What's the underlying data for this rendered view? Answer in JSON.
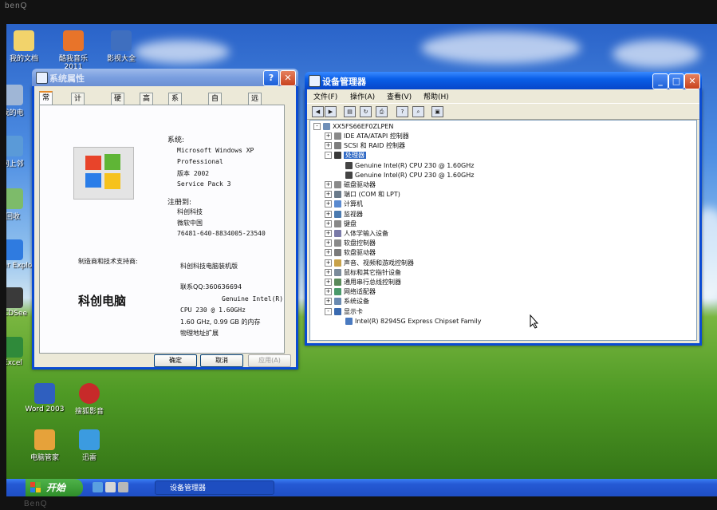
{
  "bezel": {
    "brand_top": "benQ",
    "brand_bottom": "BenQ"
  },
  "desktop": {
    "icons": [
      {
        "label": "我的文档"
      },
      {
        "label": "酷我音乐 2011"
      },
      {
        "label": "影视大全"
      },
      {
        "label": "我的电"
      },
      {
        "label": "网上邻"
      },
      {
        "label": "回收"
      },
      {
        "label": "Inter Explo"
      },
      {
        "label": "ACDSee"
      },
      {
        "label": "Excel"
      },
      {
        "label": "Word 2003"
      },
      {
        "label": "搜狐影音"
      },
      {
        "label": "电脑管家"
      },
      {
        "label": "迅雷"
      }
    ]
  },
  "sys_props": {
    "title": "系统属性",
    "help_btn": "?",
    "close_btn": "✕",
    "tabs": [
      "常规",
      "计算机名",
      "硬件",
      "高级",
      "系统还原",
      "自动更新",
      "远程"
    ],
    "system_label": "系统:",
    "os_lines": [
      "Microsoft Windows XP",
      "Professional",
      "版本 2002",
      "Service Pack 3"
    ],
    "registered_label": "注册到:",
    "reg_lines": [
      "科创科技",
      "微软中国",
      "76481-640-8834005-23540"
    ],
    "oem_label": "制造商和技术支持商:",
    "oem_logo_text": "科创电脑",
    "oem_lines": [
      "科创科技电脑装机版",
      "",
      "联系QQ:360636694"
    ],
    "hw_lines": [
      "Genuine Intel(R)",
      "CPU  230   @ 1.60GHz",
      "1.60 GHz, 0.99 GB 的内存",
      "物理地址扩展"
    ],
    "buttons": {
      "ok": "确定",
      "cancel": "取消",
      "apply": "应用(A)"
    }
  },
  "dev_mgr": {
    "title": "设备管理器",
    "controls": {
      "min": "_",
      "max": "□",
      "close": "✕"
    },
    "menu": [
      "文件(F)",
      "操作(A)",
      "查看(V)",
      "帮助(H)"
    ],
    "toolbar_icons": [
      "back-arrow-icon",
      "forward-arrow-icon",
      "properties-icon",
      "refresh-icon",
      "print-icon",
      "help-icon",
      "scan-hardware-icon",
      "device-icon"
    ],
    "computer_name": "XX5FS66EF0ZLPEN",
    "nodes": [
      {
        "label": "IDE ATA/ATAPI 控制器",
        "expander": "+"
      },
      {
        "label": "SCSI 和 RAID 控制器",
        "expander": "+"
      },
      {
        "label": "处理器",
        "expander": "-",
        "selected": true
      },
      {
        "label": "Genuine Intel(R) CPU  230   @ 1.60GHz",
        "child": true
      },
      {
        "label": "Genuine Intel(R) CPU  230   @ 1.60GHz",
        "child": true
      },
      {
        "label": "磁盘驱动器",
        "expander": "+"
      },
      {
        "label": "端口 (COM 和 LPT)",
        "expander": "+"
      },
      {
        "label": "计算机",
        "expander": "+"
      },
      {
        "label": "监视器",
        "expander": "+"
      },
      {
        "label": "键盘",
        "expander": "+"
      },
      {
        "label": "人体学输入设备",
        "expander": "+"
      },
      {
        "label": "软盘控制器",
        "expander": "+"
      },
      {
        "label": "软盘驱动器",
        "expander": "+"
      },
      {
        "label": "声音、视频和游戏控制器",
        "expander": "+"
      },
      {
        "label": "鼠标和其它指针设备",
        "expander": "+"
      },
      {
        "label": "通用串行总线控制器",
        "expander": "+"
      },
      {
        "label": "网络适配器",
        "expander": "+"
      },
      {
        "label": "系统设备",
        "expander": "+"
      },
      {
        "label": "显示卡",
        "expander": "-"
      },
      {
        "label": "Intel(R) 82945G Express Chipset Family",
        "child": true
      }
    ]
  },
  "taskbar": {
    "start_label": "开始",
    "task_item": "设备管理器"
  },
  "colors": {
    "xp_blue": "#0a4bd3",
    "selection": "#316ac5",
    "start_green": "#3a9a34"
  }
}
